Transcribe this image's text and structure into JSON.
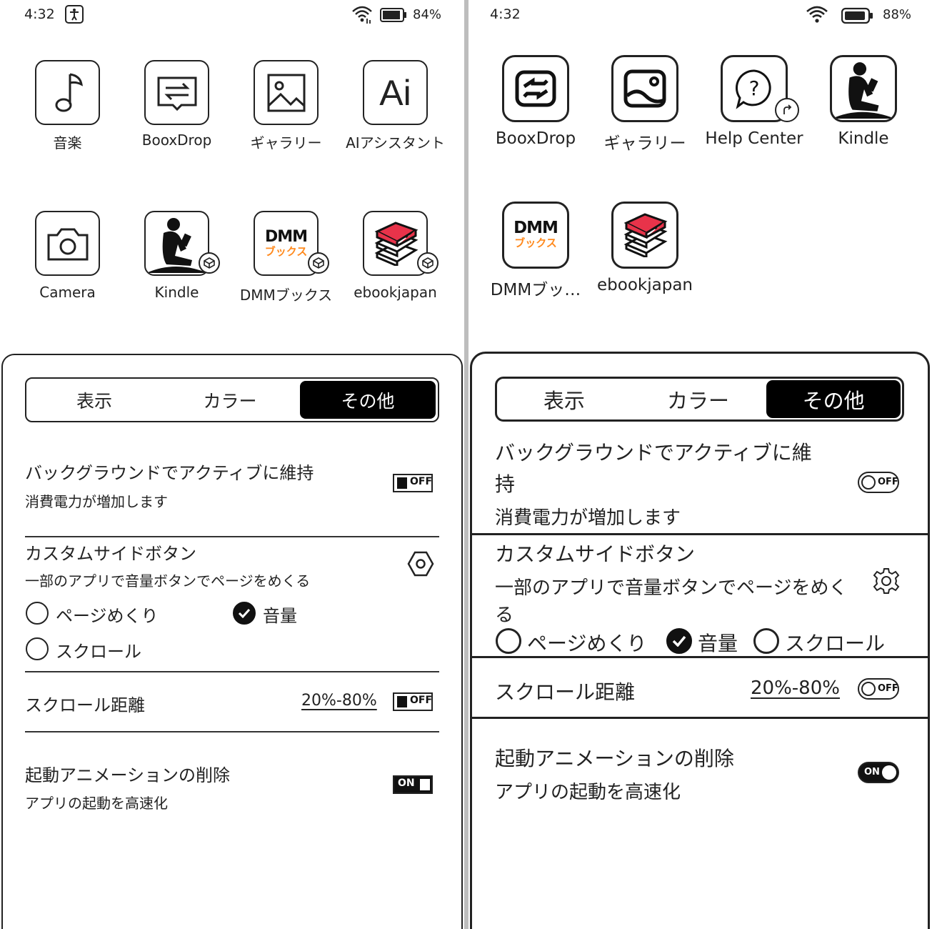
{
  "left": {
    "status": {
      "time": "4:32",
      "battery": "84%"
    },
    "apps": [
      {
        "label": "音楽",
        "icon": "music-note-icon"
      },
      {
        "label": "BooxDrop",
        "icon": "booxdrop-icon"
      },
      {
        "label": "ギャラリー",
        "icon": "gallery-icon"
      },
      {
        "label": "AIアシスタント",
        "icon": "ai-assistant-icon",
        "glyph": "Ai"
      },
      {
        "label": "Camera",
        "icon": "camera-icon"
      },
      {
        "label": "Kindle",
        "icon": "kindle-icon"
      },
      {
        "label": "DMMブックス",
        "icon": "dmm-books-icon",
        "logo_top": "DMM",
        "logo_bottom": "ブックス"
      },
      {
        "label": "ebookjapan",
        "icon": "ebookjapan-icon"
      }
    ],
    "tabs": [
      "表示",
      "カラー",
      "その他"
    ],
    "settings": {
      "background_active": {
        "title": "バックグラウンドでアクティブに維持",
        "subtitle": "消費電力が増加します",
        "toggle": "OFF"
      },
      "custom_side_button": {
        "title": "カスタムサイドボタン",
        "subtitle": "一部のアプリで音量ボタンでページをめくる",
        "options": [
          "ページめくり",
          "音量",
          "スクロール"
        ]
      },
      "scroll_distance": {
        "title": "スクロール距離",
        "value": "20%-80%",
        "toggle": "OFF"
      },
      "startup_animation": {
        "title": "起動アニメーションの削除",
        "subtitle": "アプリの起動を高速化",
        "toggle": "ON"
      }
    }
  },
  "right": {
    "status": {
      "time": "4:32",
      "battery": "88%"
    },
    "apps": [
      {
        "label": "BooxDrop",
        "icon": "booxdrop-icon"
      },
      {
        "label": "ギャラリー",
        "icon": "gallery-icon"
      },
      {
        "label": "Help Center",
        "icon": "help-center-icon",
        "glyph": "?"
      },
      {
        "label": "Kindle",
        "icon": "kindle-icon"
      },
      {
        "label": "DMMブッ…",
        "icon": "dmm-books-icon",
        "logo_top": "DMM",
        "logo_bottom": "ブックス"
      },
      {
        "label": "ebookjapan",
        "icon": "ebookjapan-icon"
      }
    ],
    "tabs": [
      "表示",
      "カラー",
      "その他"
    ],
    "settings": {
      "background_active": {
        "title_line1": "バックグラウンドでアクティブに維",
        "title_line2": "持",
        "subtitle": "消費電力が増加します",
        "toggle": "OFF"
      },
      "custom_side_button": {
        "title": "カスタムサイドボタン",
        "subtitle_line1": "一部のアプリで音量ボタンでページをめく",
        "subtitle_line2": "る",
        "options": [
          "ページめくり",
          "音量",
          "スクロール"
        ]
      },
      "scroll_distance": {
        "title": "スクロール距離",
        "value": "20%-80%",
        "toggle": "OFF"
      },
      "startup_animation": {
        "title": "起動アニメーションの削除",
        "subtitle": "アプリの起動を高速化",
        "toggle": "ON"
      }
    }
  },
  "colors": {
    "dmm_orange": "#ff8a1e",
    "ebook_red": "#e8334a"
  }
}
